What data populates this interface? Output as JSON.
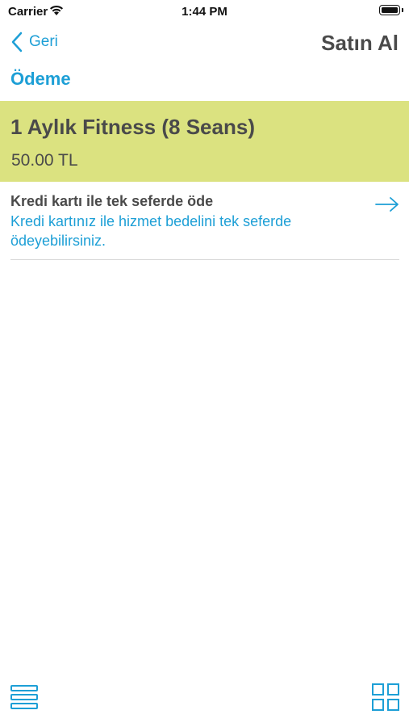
{
  "status_bar": {
    "carrier": "Carrier",
    "time": "1:44 PM"
  },
  "nav": {
    "back_label": "Geri",
    "title": "Satın Al"
  },
  "section_title": "Ödeme",
  "product": {
    "name": "1 Aylık Fitness (8 Seans)",
    "price": "50.00 TL"
  },
  "payment_option": {
    "title": "Kredi kartı ile tek seferde öde",
    "description": "Kredi kartınız ile hizmet bedelini tek seferde ödeyebilirsiniz."
  },
  "icons": {
    "wifi": "wifi-icon",
    "battery": "battery-icon",
    "back": "chevron-left-icon",
    "arrow": "arrow-right-icon",
    "menu": "list-menu-icon",
    "grid": "grid-icon"
  },
  "colors": {
    "accent": "#1d9fd6",
    "card_background": "#dbe280",
    "text": "#4a4a4a"
  }
}
